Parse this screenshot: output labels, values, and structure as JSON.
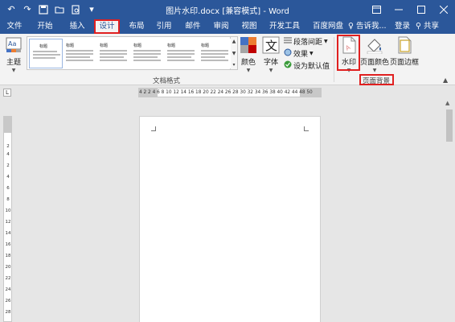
{
  "window": {
    "title": "图片水印.docx [兼容模式] - Word",
    "controls": [
      "ribbon-options",
      "minimize",
      "maximize",
      "close"
    ]
  },
  "qat": {
    "undo": "↶",
    "redo": "↷",
    "save": "⎘",
    "open": "▢",
    "print_preview": "▣",
    "more": "▾"
  },
  "tabs": [
    {
      "id": "file",
      "label": "文件"
    },
    {
      "id": "home",
      "label": "开始"
    },
    {
      "id": "insert",
      "label": "插入"
    },
    {
      "id": "design",
      "label": "设计",
      "active": true
    },
    {
      "id": "layout",
      "label": "布局"
    },
    {
      "id": "references",
      "label": "引用"
    },
    {
      "id": "mailings",
      "label": "邮件"
    },
    {
      "id": "review",
      "label": "审阅"
    },
    {
      "id": "view",
      "label": "视图"
    },
    {
      "id": "developer",
      "label": "开发工具"
    },
    {
      "id": "baidu",
      "label": "百度网盘"
    }
  ],
  "tellme": "告诉我...",
  "login": "登录",
  "share": "共享",
  "ribbon": {
    "theme": "主题",
    "gallery_thumbs": [
      {
        "title": "标题"
      },
      {
        "title": "标题"
      },
      {
        "title": "标题"
      },
      {
        "title": "标题"
      },
      {
        "title": "标题"
      },
      {
        "title": "标题"
      }
    ],
    "colors": "颜色",
    "fonts": "字体",
    "paragraph_spacing": "段落间距",
    "effects": "效果",
    "set_default": "设为默认值",
    "group_doc_format": "文档格式",
    "watermark": "水印",
    "page_color": "页面颜色",
    "page_border": "页面边框",
    "group_page_bg": "页面背景"
  },
  "ruler": {
    "tab_selector": "L",
    "numbers": "4  2    2  4  6  8 10 12 14 16 18 20 22 24 26 28 30 32 34 36 38 40 42 44   48 50",
    "vertical": [
      "2",
      "4",
      "2",
      "4",
      "6",
      "8",
      "10",
      "12",
      "14",
      "16",
      "18",
      "20",
      "22",
      "24",
      "26",
      "28"
    ]
  },
  "colors": {
    "word_blue": "#2b579a",
    "highlight_red": "#e02020",
    "ribbon_bg": "#f3f3f3"
  }
}
